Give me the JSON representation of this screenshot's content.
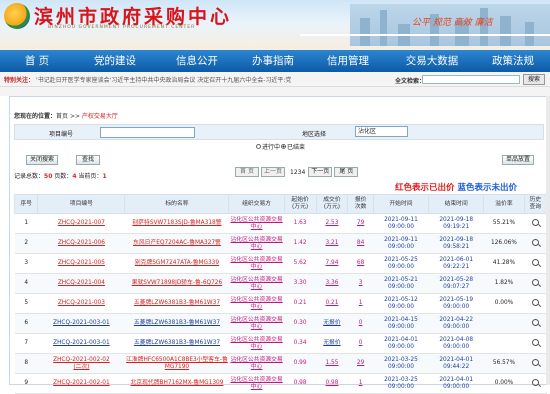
{
  "header": {
    "title": "滨州市政府采购中心",
    "subtitle": "BINZHOU GOVERNMENT PROCUREMENT CENTER",
    "slogan": "公平 规范 高效 廉洁"
  },
  "nav": [
    {
      "label": "首 页"
    },
    {
      "label": "党的建设"
    },
    {
      "label": "信息公开"
    },
    {
      "label": "办事指南"
    },
    {
      "label": "信用管理"
    },
    {
      "label": "交易大数据"
    },
    {
      "label": "政策法规"
    }
  ],
  "notice": {
    "label": "特别关注：",
    "text": "'书记赴日开医学专家座谈会'习近平主持中共中央政治局会议 决定召开十九届六中全会-习近平:党"
  },
  "search": {
    "label": "全文检索：",
    "button": "搜索"
  },
  "breadcrumb": {
    "here": "您现在的位置：",
    "home": "首页",
    "sep1": " >> ",
    "current": "产权交易大厅"
  },
  "form": {
    "project_label": "项目编号",
    "region_label": "地区选择",
    "region_value": "沾化区",
    "radio_running": "进行中",
    "radio_ended": "已结束",
    "btn_close": "关闭搜索",
    "btn_search": "查找",
    "btn_single": "单品放置"
  },
  "records": {
    "pre": "记录总数：",
    "total": "50",
    "mid": "页数：",
    "pages": "4",
    "cur_label": "当前页：",
    "cur": "1"
  },
  "pager": {
    "first": "首 页",
    "prev": "上一页",
    "page": "1234",
    "next": "下一页",
    "last": "尾 页"
  },
  "legend": {
    "red": "红色表示已出价",
    "blue": "蓝色表示未出价"
  },
  "table": {
    "headers": [
      "序号",
      "项目编号",
      "标的名称",
      "组织交易方",
      "起始价\n(万元)",
      "成交价\n(万元)",
      "报价\n次数",
      "开始时间",
      "结束时间",
      "溢价率",
      "历史\n查询"
    ],
    "rows": [
      {
        "no": "1",
        "code": "ZHCQ-2021-007",
        "name": "别萨特SVW7183SJD-鲁MA318警",
        "org": "沾化区公共资源交易中心",
        "start": "1.63",
        "deal": "2.53",
        "bids": "79",
        "t1": "2021-09-11\n09:00:00",
        "t2": "2021-09-18\n09:19:21",
        "rate": "55.21%",
        "color": "red"
      },
      {
        "no": "2",
        "code": "ZHCQ-2021-006",
        "name": "东风日产EQ7204AC-鲁MA327警",
        "org": "沾化区公共资源交易中心",
        "start": "1.42",
        "deal": "3.21",
        "bids": "84",
        "t1": "2021-09-11\n09:00:00",
        "t2": "2021-09-18\n09:58:21",
        "rate": "126.06%",
        "color": "red"
      },
      {
        "no": "3",
        "code": "ZHCQ-2021-005",
        "name": "别克牌SGM7247ATA-鲁MG339",
        "org": "沾化区公共资源交易中心",
        "start": "5.62",
        "deal": "7.94",
        "bids": "68",
        "t1": "2021-05-25\n09:00:00",
        "t2": "2021-06-01\n09:22:21",
        "rate": "41.28%",
        "color": "red"
      },
      {
        "no": "4",
        "code": "ZHCQ-2021-004",
        "name": "果就SVW71898JD轿车-鲁-6Q726",
        "org": "沾化区公共资源交易中心",
        "start": "3.30",
        "deal": "3.36",
        "bids": "3",
        "t1": "2021-05-21\n09:00:00",
        "t2": "2021-05-28\n09:07:27",
        "rate": "1.82%",
        "color": "red"
      },
      {
        "no": "5",
        "code": "ZHCQ-2021-003",
        "name": "五菱牌LZW6381B3-鲁M61W37",
        "org": "沾化区公共资源交易中心",
        "start": "0.21",
        "deal": "0.21",
        "bids": "1",
        "t1": "2021-05-12\n09:00:00",
        "t2": "2021-05-19\n09:00:00",
        "rate": "0.00%",
        "color": "red"
      },
      {
        "no": "6",
        "code": "ZHCQ-2021-003-01",
        "name": "五菱牌LZW6381B3-鲁M61W37",
        "org": "沾化区公共资源交易中心",
        "start": "0.30",
        "deal": "无报价",
        "bids": "0",
        "t1": "2021-04-15\n09:00:00",
        "t2": "2021-04-22\n09:00:00",
        "rate": "",
        "color": "blue"
      },
      {
        "no": "7",
        "code": "ZHCQ-2021-003-01",
        "name": "五菱牌LZW6381B3-鲁M61W37",
        "org": "沾化区公共资源交易中心",
        "start": "0.34",
        "deal": "无报价",
        "bids": "0",
        "t1": "2021-04-01\n09:00:00",
        "t2": "2021-04-08\n09:00:00",
        "rate": "",
        "color": "blue"
      },
      {
        "no": "8",
        "code": "ZHCQ-2021-002-02\n(二次)",
        "name": "江淮牌HFC6500A1C8BE3小型客车-鲁MG7190",
        "org": "沾化区公共资源交易中心",
        "start": "0.99",
        "deal": "1.55",
        "bids": "29",
        "t1": "2021-03-25\n09:00:00",
        "t2": "2021-04-01\n09:44:22",
        "rate": "56.57%",
        "color": "red"
      },
      {
        "no": "9",
        "code": "ZHCQ-2021-002-01",
        "name": "北京现代牌BH7162MX-鲁MG1309",
        "org": "沾化区公共资源交易中心",
        "start": "0.98",
        "deal": "0.98",
        "bids": "1",
        "t1": "2021-03-25\n09:00:00",
        "t2": "2021-04-01\n09:00:00",
        "rate": "0.00%",
        "color": "red"
      }
    ]
  }
}
